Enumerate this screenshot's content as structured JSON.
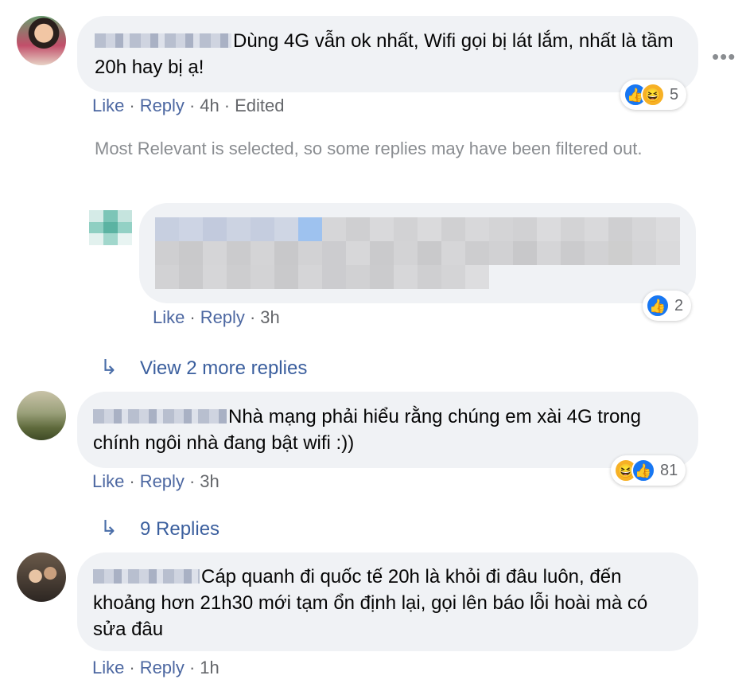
{
  "comments": [
    {
      "text": "Dùng 4G vẫn ok nhất, Wifi gọi bị lát lắm, nhất là tầm 20h hay bị ạ!",
      "actions": {
        "like": "Like",
        "reply": "Reply",
        "time": "4h",
        "edited": "Edited"
      },
      "reaction_count": "5",
      "reaction_icons": [
        "like-icon",
        "haha-icon"
      ]
    },
    {
      "text": "Nhà mạng phải hiểu rằng chúng em xài 4G trong chính ngôi nhà đang bật wifi :))",
      "actions": {
        "like": "Like",
        "reply": "Reply",
        "time": "3h"
      },
      "reaction_count": "81",
      "reaction_icons": [
        "haha-icon",
        "like-icon"
      ]
    },
    {
      "text": "Cáp quanh đi quốc tế 20h là khỏi đi đâu luôn, đến khoảng hơn 21h30 mới tạm ổn định lại, gọi lên báo lỗi hoài mà có sửa đâu",
      "actions": {
        "like": "Like",
        "reply": "Reply",
        "time": "1h"
      }
    }
  ],
  "filter_notice": "Most Relevant is selected, so some replies may have been filtered out.",
  "reply": {
    "actions": {
      "like": "Like",
      "reply": "Reply",
      "time": "3h"
    },
    "reaction_count": "2",
    "reaction_icons": [
      "like-icon"
    ]
  },
  "view_more_replies": "View 2 more replies",
  "replies_link": "9 Replies",
  "colors": {
    "link": "#4c67a1",
    "muted": "#65676b",
    "bubble": "#f0f2f5",
    "like_blue": "#1877f2",
    "haha_yellow": "#f7b125"
  }
}
